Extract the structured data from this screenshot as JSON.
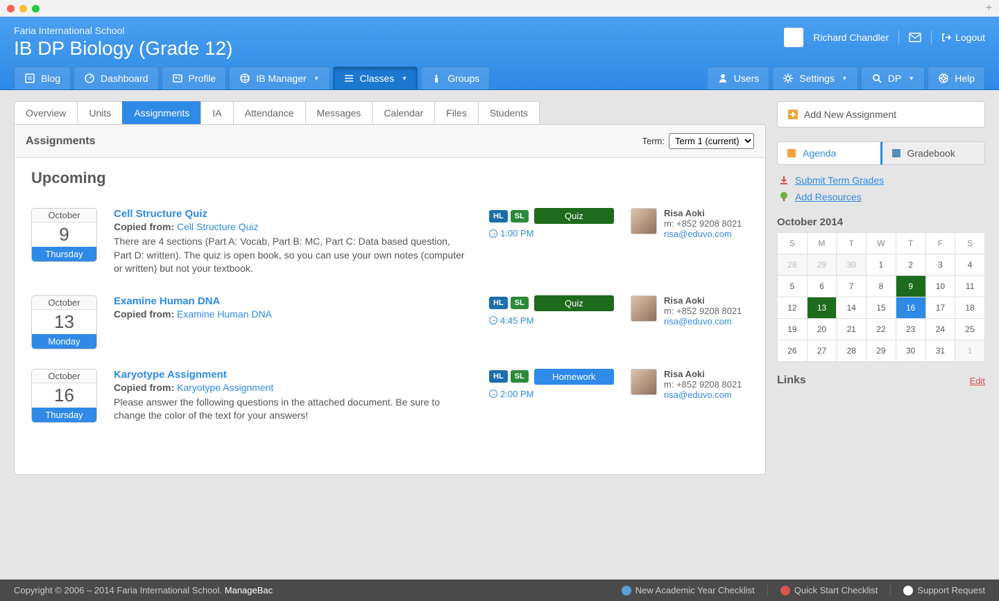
{
  "school": "Faria International School",
  "page_title": "IB DP Biology (Grade 12)",
  "user_name": "Richard Chandler",
  "logout": "Logout",
  "main_nav_left": [
    {
      "label": "Blog",
      "icon": "blog"
    },
    {
      "label": "Dashboard",
      "icon": "dash"
    },
    {
      "label": "Profile",
      "icon": "profile"
    },
    {
      "label": "IB Manager",
      "icon": "ib",
      "dd": true
    },
    {
      "label": "Classes",
      "icon": "classes",
      "dd": true,
      "active": true
    },
    {
      "label": "Groups",
      "icon": "groups"
    }
  ],
  "main_nav_right": [
    {
      "label": "Users",
      "icon": "users"
    },
    {
      "label": "Settings",
      "icon": "settings",
      "dd": true
    },
    {
      "label": "DP",
      "icon": "search",
      "dd": true
    },
    {
      "label": "Help",
      "icon": "help"
    }
  ],
  "subtabs": [
    "Overview",
    "Units",
    "Assignments",
    "IA",
    "Attendance",
    "Messages",
    "Calendar",
    "Files",
    "Students"
  ],
  "subtab_active": "Assignments",
  "panel_title": "Assignments",
  "term_label": "Term:",
  "term_value": "Term 1 (current)",
  "section_title": "Upcoming",
  "assignments": [
    {
      "month": "October",
      "day": "9",
      "dow": "Thursday",
      "title": "Cell Structure Quiz",
      "copied_label": "Copied from:",
      "copied": "Cell Structure Quiz",
      "desc": "There are 4 sections (Part A: Vocab, Part B: MC, Part C: Data based question, Part D: written). The quiz is open book, so you can use your own notes (computer or written) but not your textbook.",
      "hl": "HL",
      "sl": "SL",
      "type": "Quiz",
      "type_class": "type-quiz",
      "time": "1:00 PM",
      "teacher": "Risa Aoki",
      "phone": "m: +852 9208 8021",
      "email": "risa@eduvo.com"
    },
    {
      "month": "October",
      "day": "13",
      "dow": "Monday",
      "title": "Examine Human DNA",
      "copied_label": "Copied from:",
      "copied": "Examine Human DNA",
      "desc": "",
      "hl": "HL",
      "sl": "SL",
      "type": "Quiz",
      "type_class": "type-quiz",
      "time": "4:45 PM",
      "teacher": "Risa Aoki",
      "phone": "m: +852 9208 8021",
      "email": "risa@eduvo.com"
    },
    {
      "month": "October",
      "day": "16",
      "dow": "Thursday",
      "title": "Karyotype Assignment",
      "copied_label": "Copied from:",
      "copied": "Karyotype Assignment",
      "desc": "Please answer the following questions in the attached document. Be sure to change the color of the text for your answers!",
      "hl": "HL",
      "sl": "SL",
      "type": "Homework",
      "type_class": "type-hw",
      "time": "2:00 PM",
      "teacher": "Risa Aoki",
      "phone": "m: +852 9208 8021",
      "email": "risa@eduvo.com"
    }
  ],
  "sidebar": {
    "add_btn": "Add New Assignment",
    "toggle": [
      {
        "label": "Agenda",
        "active": true
      },
      {
        "label": "Gradebook",
        "active": false
      }
    ],
    "links": [
      {
        "label": "Submit Term Grades",
        "icon": "upload"
      },
      {
        "label": "Add Resources",
        "icon": "tree"
      }
    ],
    "cal_title": "October 2014",
    "cal_days": [
      "S",
      "M",
      "T",
      "W",
      "T",
      "F",
      "S"
    ],
    "cal_rows": [
      [
        {
          "n": "28",
          "dim": true
        },
        {
          "n": "29",
          "dim": true
        },
        {
          "n": "30",
          "dim": true
        },
        {
          "n": "1"
        },
        {
          "n": "2"
        },
        {
          "n": "3"
        },
        {
          "n": "4"
        }
      ],
      [
        {
          "n": "5"
        },
        {
          "n": "6"
        },
        {
          "n": "7"
        },
        {
          "n": "8"
        },
        {
          "n": "9",
          "cls": "evt"
        },
        {
          "n": "10"
        },
        {
          "n": "11"
        }
      ],
      [
        {
          "n": "12"
        },
        {
          "n": "13",
          "cls": "evt"
        },
        {
          "n": "14"
        },
        {
          "n": "15"
        },
        {
          "n": "16",
          "cls": "evt2"
        },
        {
          "n": "17"
        },
        {
          "n": "18"
        }
      ],
      [
        {
          "n": "19"
        },
        {
          "n": "20"
        },
        {
          "n": "21"
        },
        {
          "n": "22"
        },
        {
          "n": "23"
        },
        {
          "n": "24"
        },
        {
          "n": "25"
        }
      ],
      [
        {
          "n": "26"
        },
        {
          "n": "27"
        },
        {
          "n": "28"
        },
        {
          "n": "29"
        },
        {
          "n": "30"
        },
        {
          "n": "31"
        },
        {
          "n": "1",
          "dim": true
        }
      ]
    ],
    "links_hd": "Links",
    "edit": "Edit"
  },
  "footer": {
    "copy": "Copyright © 2006 – 2014 Faria International School. ",
    "brand": "ManageBac",
    "links": [
      "New Academic Year Checklist",
      "Quick Start Checklist",
      "Support Request"
    ]
  }
}
